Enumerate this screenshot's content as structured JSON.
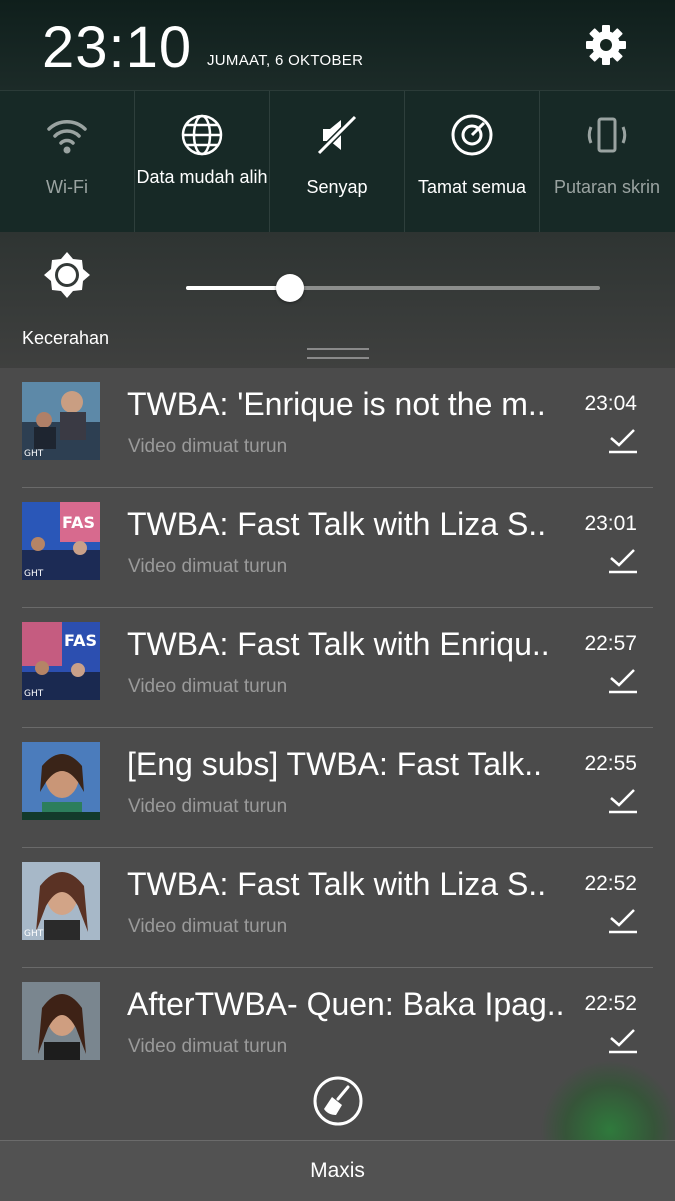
{
  "status": {
    "time": "23:10",
    "date": "JUMAAT, 6 OKTOBER"
  },
  "quick_settings": [
    {
      "label": "Wi-Fi",
      "icon": "wifi-icon",
      "active": false
    },
    {
      "label": "Data mudah alih",
      "icon": "globe-icon",
      "active": true
    },
    {
      "label": "Senyap",
      "icon": "mute-icon",
      "active": true
    },
    {
      "label": "Tamat semua",
      "icon": "close-all-icon",
      "active": true
    },
    {
      "label": "Putaran skrin",
      "icon": "rotate-icon",
      "active": false
    }
  ],
  "brightness": {
    "label": "Kecerahan",
    "level": 0.25
  },
  "notifications": [
    {
      "title": "TWBA: 'Enrique is not the m..",
      "subtitle": "Video dimuat turun",
      "time": "23:04"
    },
    {
      "title": "TWBA: Fast Talk with Liza S..",
      "subtitle": "Video dimuat turun",
      "time": "23:01"
    },
    {
      "title": "TWBA: Fast Talk with Enriqu..",
      "subtitle": "Video dimuat turun",
      "time": "22:57"
    },
    {
      "title": "[Eng subs] TWBA: Fast Talk..",
      "subtitle": "Video dimuat turun",
      "time": "22:55"
    },
    {
      "title": "TWBA: Fast Talk with Liza S..",
      "subtitle": "Video dimuat turun",
      "time": "22:52"
    },
    {
      "title": "AfterTWBA- Quen: Baka Ipag..",
      "subtitle": "Video dimuat turun",
      "time": "22:52"
    }
  ],
  "carrier": "Maxis",
  "colors": {
    "panel": "#4b4b4b",
    "header": "#172926",
    "accent_green": "#2f7a3c"
  }
}
